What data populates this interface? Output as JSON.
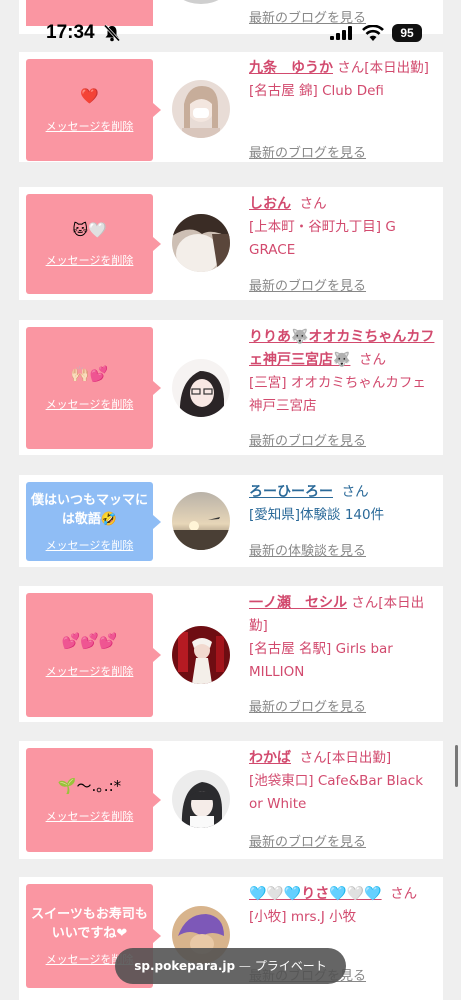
{
  "status_bar": {
    "time": "17:34",
    "battery": "95"
  },
  "partial_card": {
    "link": "最新のブログを見る"
  },
  "delete_label": "メッセージを削除",
  "cards": [
    {
      "message": "❤️",
      "name": "九条　ゆうか",
      "san": "さん",
      "status": "[本日出勤]",
      "shop": "[名古屋 錦] Club Defi",
      "link": "最新のブログを見る"
    },
    {
      "message": "🐱🤍",
      "name": "しおん",
      "san": "さん",
      "status": "",
      "shop": "[上本町・谷町九丁目] G GRACE",
      "link": "最新のブログを見る"
    },
    {
      "message": "🙌🏻💕",
      "name": "りりあ🐺オオカミちゃんカフェ神戸三宮店🐺",
      "san": "さん",
      "status": "",
      "shop": "[三宮] オオカミちゃんカフェ神戸三宮店",
      "link": "最新のブログを見る"
    },
    {
      "message": "僕はいつもマッマには敬語🤣",
      "name": "ろーひーろー",
      "san": "さん",
      "status": "",
      "shop": "[愛知県]体験談 140件",
      "link": "最新の体験談を見る"
    },
    {
      "message": "💕💕💕",
      "name": "一ノ瀬　セシル",
      "san": "さん",
      "status": "[本日出勤]",
      "shop": "[名古屋 名駅] Girls bar MILLION",
      "link": "最新のブログを見る"
    },
    {
      "message": "🌱〜.｡.:*",
      "name": "わかば",
      "san": "さん",
      "status": "[本日出勤]",
      "shop": "[池袋東口] Cafe&Bar Black or White",
      "link": "最新のブログを見る"
    },
    {
      "message": "スイーツもお寿司もいいですね❤",
      "name": "🩵🤍🩵りさ🩵🤍🩵",
      "san": "さん",
      "status": "",
      "shop": "[小牧] mrs.J 小牧",
      "link": "最新のブログを見る"
    }
  ],
  "url_bar": {
    "domain": "sp.pokepara.jp",
    "separator": " — ",
    "mode": "プライベート"
  },
  "colors": {
    "pink": "#fa96a2",
    "blue": "#8fbdf5",
    "name_pink": "#d24a6e",
    "name_blue": "#2b6a99"
  }
}
